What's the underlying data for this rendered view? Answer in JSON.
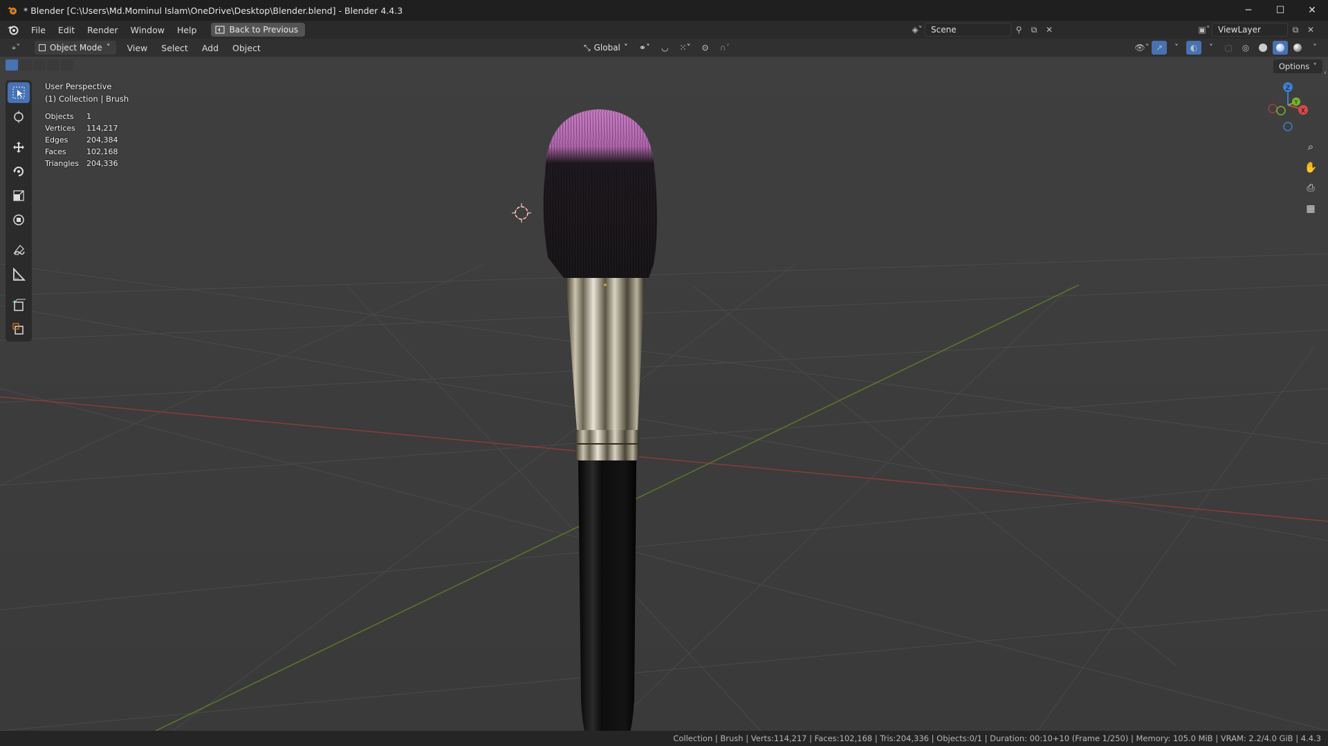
{
  "window": {
    "title": "* Blender [C:\\Users\\Md.Mominul Islam\\OneDrive\\Desktop\\Blender.blend] - Blender 4.4.3",
    "minimize_icon": "minimize-icon",
    "maximize_icon": "maximize-icon",
    "close_icon": "close-icon"
  },
  "menubar": {
    "items": [
      "File",
      "Edit",
      "Render",
      "Window",
      "Help"
    ],
    "back_button": "Back to Previous",
    "scene": "Scene",
    "view_layer": "ViewLayer"
  },
  "viewport_header": {
    "mode": "Object Mode",
    "menus": [
      "View",
      "Select",
      "Add",
      "Object"
    ],
    "transform_orientation": "Global",
    "options_label": "Options"
  },
  "overlay": {
    "perspective": "User Perspective",
    "collection": "(1) Collection | Brush",
    "stats": [
      {
        "label": "Objects",
        "value": "1"
      },
      {
        "label": "Vertices",
        "value": "114,217"
      },
      {
        "label": "Edges",
        "value": "204,384"
      },
      {
        "label": "Faces",
        "value": "102,168"
      },
      {
        "label": "Triangles",
        "value": "204,336"
      }
    ]
  },
  "gizmo": {
    "z": "Z",
    "y": "Y",
    "x": "X"
  },
  "statusbar": {
    "text": "Collection | Brush | Verts:114,217 | Faces:102,168 | Tris:204,336 | Objects:0/1 | Duration: 00:10+10 (Frame 1/250) | Memory: 105.0 MiB | VRAM: 2.2/4.0 GiB | 4.4.3"
  },
  "colors": {
    "accent": "#4772b3",
    "x_axis": "#d64a4a",
    "y_axis": "#79b32d",
    "z_axis": "#3e7fd1",
    "bristle_tip": "#c97ac4"
  }
}
